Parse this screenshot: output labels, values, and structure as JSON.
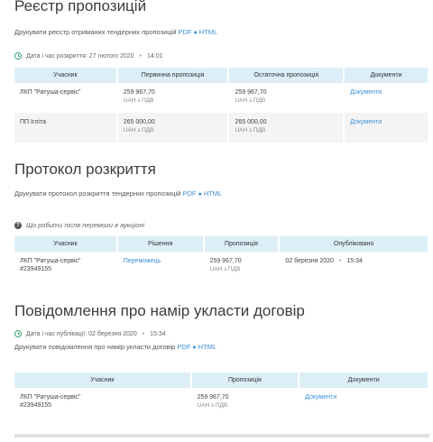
{
  "registry": {
    "title": "Реєстр пропозицій",
    "print_text": "Друкувати реєстр отриманих тендерних пропозицій",
    "pdf": "PDF",
    "html": "HTML",
    "opened_label": "Дата і час розкриття: 27 лютого 2020",
    "opened_time": "14:01",
    "headers": [
      "Учасник",
      "Первинна пропозиція",
      "Остаточна пропозиція",
      "Документи"
    ],
    "rows": [
      {
        "participant": "ЛКП \"Ратуша-сервіс\"",
        "initial": "259 967,70",
        "initial_sub": "UAH з ПДВ",
        "final": "259 967,70",
        "final_sub": "UAH з ПДВ",
        "docs": "Документи"
      },
      {
        "participant": "ПП Ігліта",
        "initial": "265 000,00",
        "initial_sub": "UAH з ПДВ",
        "final": "265 000,00",
        "final_sub": "UAH з ПДВ",
        "docs": "Документи"
      }
    ]
  },
  "protocol": {
    "title": "Протокол розкриття",
    "print_text": "Друкувати протокол розкриття тендерних пропозицій",
    "pdf": "PDF",
    "html": "HTML",
    "info_text": "Що робити після перемоги в аукціоні",
    "headers": [
      "Учасник",
      "Рішення",
      "Пропозиція",
      "Опубліковано"
    ],
    "rows": [
      {
        "participant": "ЛКП \"Ратуша-сервіс\"",
        "participant_id": "#23949155",
        "decision": "Переможець",
        "offer": "259 967,70",
        "offer_sub": "UAH з ПДВ",
        "published": "02 березня 2020",
        "published_time": "15:34"
      }
    ]
  },
  "notice": {
    "title": "Повідомлення про намір укласти договір",
    "published_label": "Дата і час публікації: 02 березня 2020",
    "published_time": "15:34",
    "print_text": "Друкувати повідомлення про намір укласти договір",
    "pdf": "PDF",
    "html": "HTML",
    "headers": [
      "Учасник",
      "Пропозиція",
      "Документи"
    ],
    "rows": [
      {
        "participant": "ЛКП \"Ратуша-сервіс\"",
        "participant_id": "#23949155",
        "offer": "259 967,70",
        "offer_sub": "UAH з ПДВ",
        "docs": "Документи"
      }
    ]
  }
}
